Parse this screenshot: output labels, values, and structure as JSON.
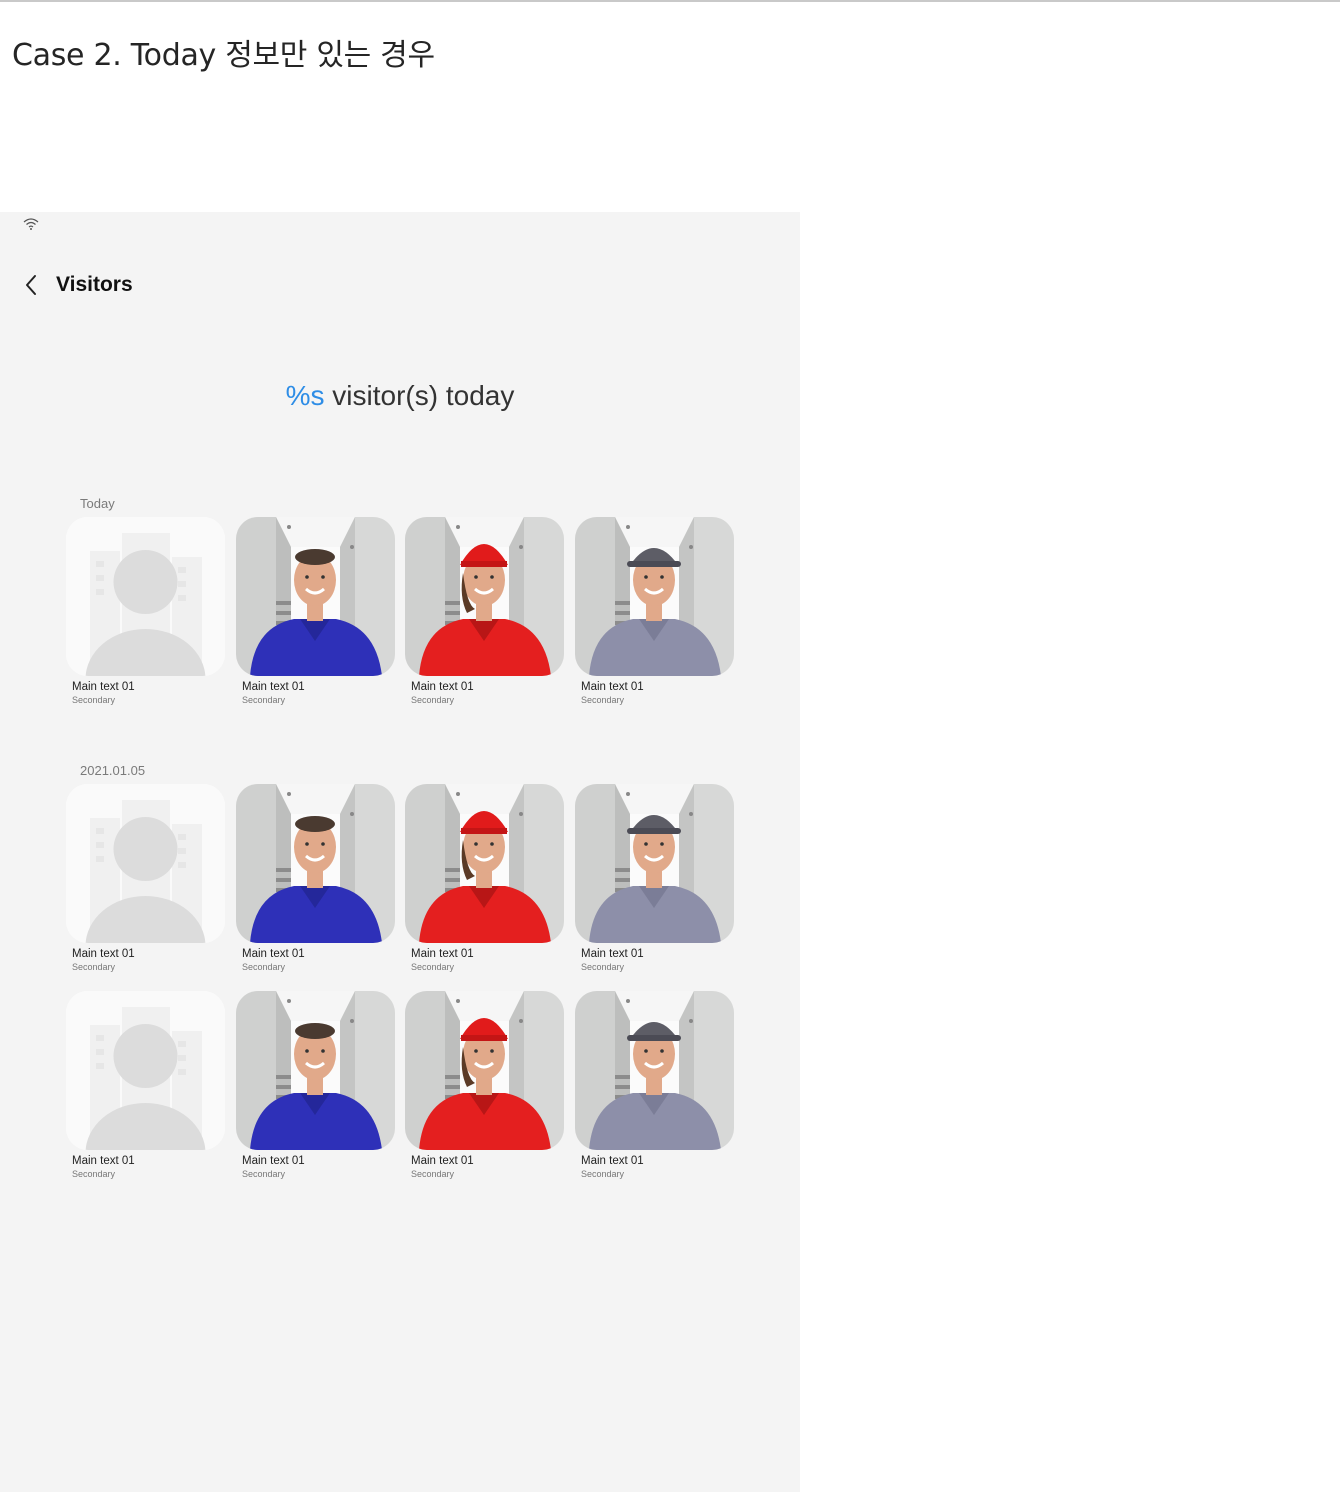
{
  "doc": {
    "case_title": "Case 2. Today 정보만 있는 경우"
  },
  "app_bar": {
    "title": "Visitors"
  },
  "summary": {
    "count": "%s",
    "text": " visitor(s) today"
  },
  "sections": [
    {
      "label": "Today",
      "rows": [
        [
          {
            "type": "placeholder",
            "main": "Main text 01",
            "sub": "Secondary"
          },
          {
            "type": "man-blue",
            "main": "Main text 01",
            "sub": "Secondary"
          },
          {
            "type": "woman-red",
            "main": "Main text 01",
            "sub": "Secondary"
          },
          {
            "type": "man-cap-gray",
            "main": "Main text 01",
            "sub": "Secondary"
          }
        ]
      ]
    },
    {
      "label": "2021.01.05",
      "rows": [
        [
          {
            "type": "placeholder",
            "main": "Main text 01",
            "sub": "Secondary"
          },
          {
            "type": "man-blue",
            "main": "Main text 01",
            "sub": "Secondary"
          },
          {
            "type": "woman-red",
            "main": "Main text 01",
            "sub": "Secondary"
          },
          {
            "type": "man-cap-gray",
            "main": "Main text 01",
            "sub": "Secondary"
          }
        ],
        [
          {
            "type": "placeholder",
            "main": "Main text 01",
            "sub": "Secondary"
          },
          {
            "type": "man-blue",
            "main": "Main text 01",
            "sub": "Secondary"
          },
          {
            "type": "woman-red",
            "main": "Main text 01",
            "sub": "Secondary"
          },
          {
            "type": "man-cap-gray",
            "main": "Main text 01",
            "sub": "Secondary"
          }
        ]
      ]
    }
  ],
  "colors": {
    "accent": "#2e8de6",
    "background": "#f4f4f4"
  },
  "icons": {
    "back": "chevron-left-icon",
    "status": "wifi-icon"
  }
}
